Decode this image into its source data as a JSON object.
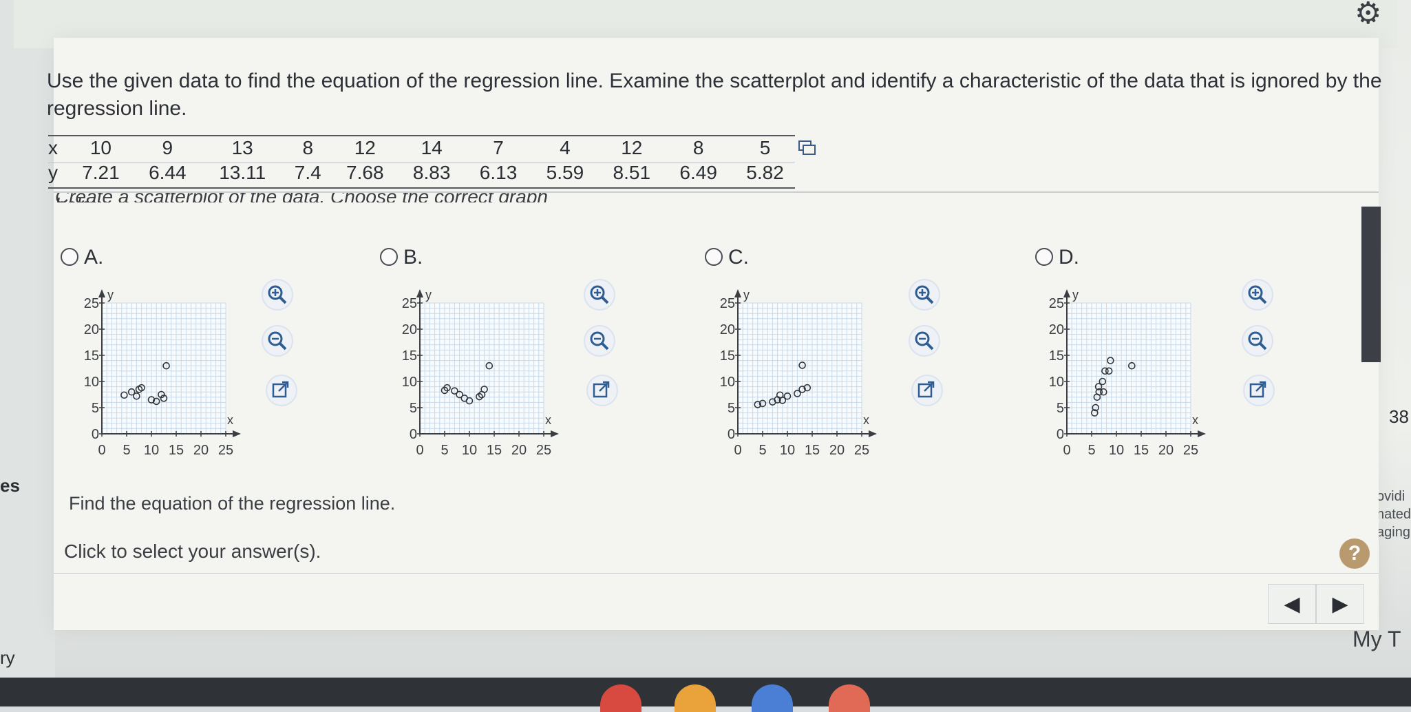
{
  "instructions": "Use the given data to find the equation of the regression line. Examine the scatterplot and identify a characteristic of the data that is ignored by the regression line.",
  "table": {
    "x_label": "x",
    "y_label": "y",
    "x": [
      "10",
      "9",
      "13",
      "8",
      "12",
      "14",
      "7",
      "4",
      "12",
      "8",
      "5"
    ],
    "y": [
      "7.21",
      "6.44",
      "13.11",
      "7.4",
      "7.68",
      "8.83",
      "6.13",
      "5.59",
      "8.51",
      "6.49",
      "5.82"
    ]
  },
  "scatter_instruction": "Create a scatterplot of the data. Choose the correct graph below.",
  "options": [
    {
      "label": "A."
    },
    {
      "label": "B."
    },
    {
      "label": "C."
    },
    {
      "label": "D."
    }
  ],
  "graph_axis": {
    "ylabel": "y",
    "xlabel": "x",
    "yticks": [
      "25",
      "20",
      "15",
      "10",
      "5",
      "0"
    ],
    "xticks": [
      "0",
      "5",
      "10",
      "15",
      "20",
      "25"
    ]
  },
  "chart_data": [
    {
      "type": "scatter",
      "title": "",
      "xlabel": "x",
      "ylabel": "y",
      "xlim": [
        0,
        25
      ],
      "ylim": [
        0,
        25
      ],
      "grid": true,
      "points": [
        [
          4.5,
          7.4
        ],
        [
          6,
          8
        ],
        [
          7,
          7.2
        ],
        [
          7.5,
          8.5
        ],
        [
          8,
          8.8
        ],
        [
          10,
          6.5
        ],
        [
          11,
          6.2
        ],
        [
          12,
          7.5
        ],
        [
          12.5,
          6.8
        ],
        [
          13,
          13
        ]
      ]
    },
    {
      "type": "scatter",
      "title": "",
      "xlabel": "x",
      "ylabel": "y",
      "xlim": [
        0,
        25
      ],
      "ylim": [
        0,
        25
      ],
      "grid": true,
      "points": [
        [
          5,
          8.3
        ],
        [
          5.5,
          8.8
        ],
        [
          7,
          8.2
        ],
        [
          8,
          7.5
        ],
        [
          9,
          6.8
        ],
        [
          10,
          6.3
        ],
        [
          12,
          7.1
        ],
        [
          12.5,
          7.5
        ],
        [
          13,
          8.5
        ],
        [
          14,
          13
        ]
      ]
    },
    {
      "type": "scatter",
      "title": "",
      "xlabel": "x",
      "ylabel": "y",
      "xlim": [
        0,
        25
      ],
      "ylim": [
        0,
        25
      ],
      "grid": true,
      "points": [
        [
          4,
          5.6
        ],
        [
          5,
          5.8
        ],
        [
          7,
          6.1
        ],
        [
          8,
          6.5
        ],
        [
          8.5,
          7.4
        ],
        [
          9,
          6.4
        ],
        [
          10,
          7.2
        ],
        [
          12,
          7.7
        ],
        [
          13,
          8.5
        ],
        [
          14,
          8.8
        ],
        [
          13,
          13.1
        ]
      ]
    },
    {
      "type": "scatter",
      "title": "",
      "xlabel": "x",
      "ylabel": "y",
      "xlim": [
        0,
        25
      ],
      "ylim": [
        0,
        25
      ],
      "grid": true,
      "points": [
        [
          5.6,
          4
        ],
        [
          5.8,
          5
        ],
        [
          6.1,
          7
        ],
        [
          6.5,
          8
        ],
        [
          6.4,
          9
        ],
        [
          7.2,
          10
        ],
        [
          7.4,
          8
        ],
        [
          7.7,
          12
        ],
        [
          8.5,
          12
        ],
        [
          8.8,
          14
        ],
        [
          13.1,
          13
        ]
      ]
    }
  ],
  "prompt": "Find the equation of the regression line.",
  "answer_prompt": "Click to select your answer(s).",
  "help": "?",
  "side": {
    "left_1": "es",
    "left_2": "ry",
    "right_1": "38",
    "right_2_a": "ovidi",
    "right_2_b": "nated",
    "right_2_c": "aging",
    "right_3": "My T"
  },
  "nav": {
    "prev": "◀",
    "next": "▶"
  },
  "colors": {
    "panel": "#f4f5f1",
    "grid": "#c7d9e8",
    "axis": "#3b3f44",
    "help": "#b99a6e"
  }
}
